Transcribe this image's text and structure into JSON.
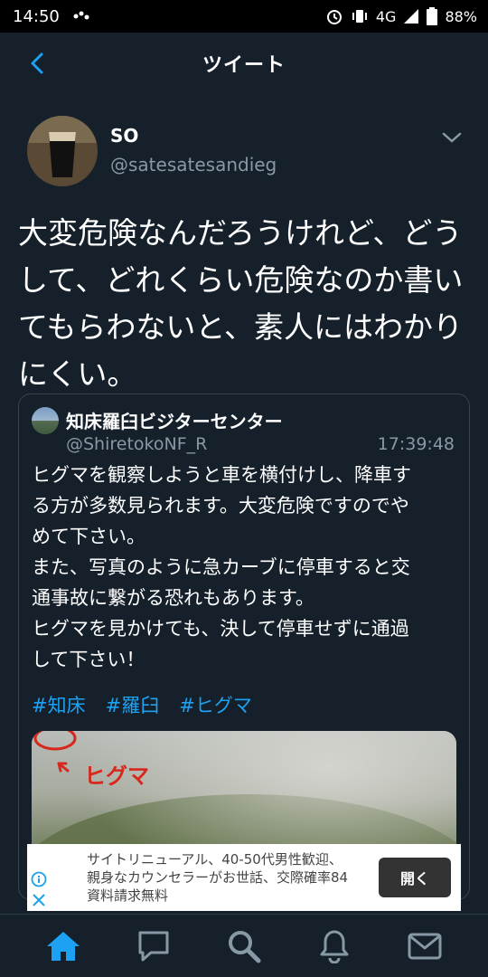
{
  "status_bar": {
    "time": "14:50",
    "network": "4G",
    "battery": "88%",
    "icons": [
      "alarm-icon",
      "vibrate-icon",
      "signal-icon",
      "battery-icon"
    ]
  },
  "header": {
    "title": "ツイート",
    "back_icon": "chevron-left-icon"
  },
  "tweet": {
    "author_name": "SO",
    "author_handle": "@satesatesandieg",
    "text": "大変危険なんだろうけれど、どうして、どれくらい危険なのか書いてもらわないと、素人にはわかりにくい。"
  },
  "quoted_tweet": {
    "author_name": "知床羅臼ビジターセンター",
    "author_handle": "@ShiretokoNF_R",
    "time": "17:39:48",
    "body_lines": [
      "ヒグマを観察しようと車を横付けし、降車す",
      "る方が多数見られます。大変危険ですのでや",
      "めて下さい。",
      "また、写真のように急カーブに停車すると交",
      "通事故に繋がる恐れもあります。",
      "ヒグマを見かけても、決して停車せずに通過",
      "して下さい！"
    ],
    "hashtags": [
      "#知床",
      "#羅臼",
      "#ヒグマ"
    ],
    "image_label": "ヒグマ"
  },
  "ad": {
    "lines": [
      "サイトリニューアル、40-50代男性歓迎、",
      "親身なカウンセラーがお世話、交際確率84",
      "資料請求無料"
    ],
    "button_label": "開く"
  },
  "tab_bar": {
    "items": [
      "home-icon",
      "messages-bubble-icon",
      "search-icon",
      "notifications-icon",
      "mail-icon"
    ],
    "active": "home-icon",
    "active_color": "#1da1f2",
    "inactive_color": "#8899a6"
  }
}
